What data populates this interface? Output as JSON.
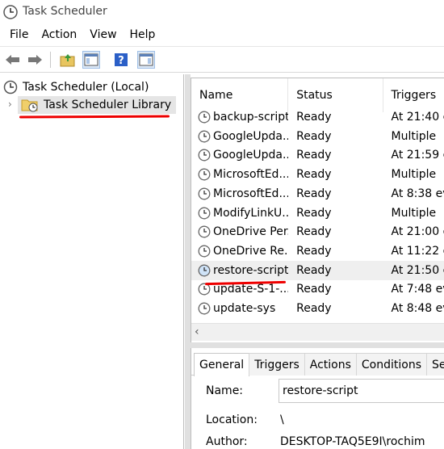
{
  "window": {
    "title": "Task Scheduler"
  },
  "menu": [
    "File",
    "Action",
    "View",
    "Help"
  ],
  "toolbar": {
    "back_icon": "arrow-left-icon",
    "forward_icon": "arrow-right-icon",
    "up_folder_icon": "folder-up-icon",
    "show_hide_icon": "console-tree-icon",
    "help_icon": "help-icon",
    "action_pane_icon": "action-pane-icon"
  },
  "tree": {
    "root": "Task Scheduler (Local)",
    "library": "Task Scheduler Library"
  },
  "list": {
    "columns": [
      "Name",
      "Status",
      "Triggers"
    ],
    "rows": [
      {
        "name": "backup-script",
        "status": "Ready",
        "triggers": "At 21:40 e"
      },
      {
        "name": "GoogleUpda...",
        "status": "Ready",
        "triggers": "Multiple"
      },
      {
        "name": "GoogleUpda...",
        "status": "Ready",
        "triggers": "At 21:59 e"
      },
      {
        "name": "MicrosoftEd...",
        "status": "Ready",
        "triggers": "Multiple"
      },
      {
        "name": "MicrosoftEd...",
        "status": "Ready",
        "triggers": "At 8:38 ev"
      },
      {
        "name": "ModifyLinkU...",
        "status": "Ready",
        "triggers": "Multiple"
      },
      {
        "name": "OneDrive Per...",
        "status": "Ready",
        "triggers": "At 21:00 o"
      },
      {
        "name": "OneDrive Re...",
        "status": "Ready",
        "triggers": "At 11:22 o"
      },
      {
        "name": "restore-script",
        "status": "Ready",
        "triggers": "At 21:50 e"
      },
      {
        "name": "update-S-1-...",
        "status": "Ready",
        "triggers": "At 7:48 ev"
      },
      {
        "name": "update-sys",
        "status": "Ready",
        "triggers": "At 8:48 ev"
      }
    ],
    "selected_index": 8
  },
  "detail": {
    "tabs": [
      "General",
      "Triggers",
      "Actions",
      "Conditions",
      "Set"
    ],
    "active_tab": 0,
    "name_label": "Name:",
    "name_value": "restore-script",
    "location_label": "Location:",
    "location_value": "\\",
    "author_label": "Author:",
    "author_value": "DESKTOP-TAQ5E9I\\rochim"
  },
  "colors": {
    "annotation": "#e00000",
    "selected_row": "#efefef",
    "help_blue": "#2b5fc7"
  }
}
